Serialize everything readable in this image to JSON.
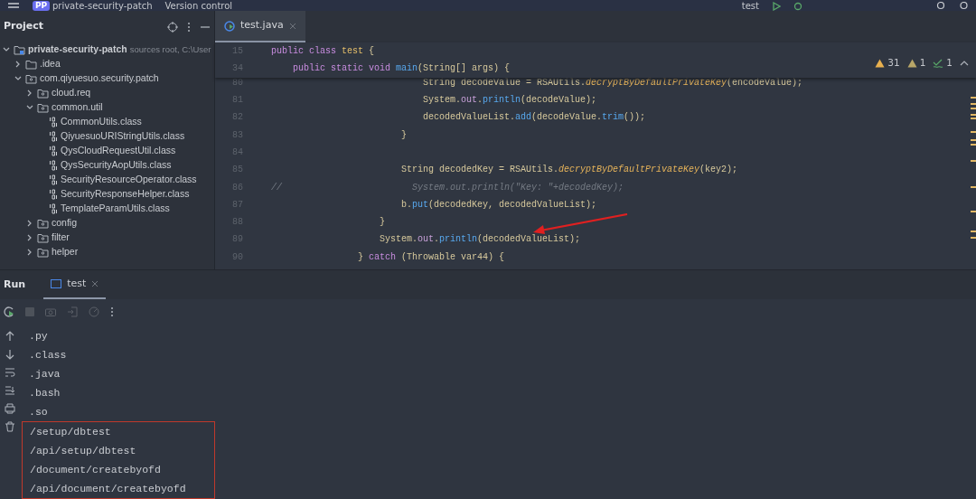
{
  "toolbar": {
    "project_badge": "PP",
    "project_name": "private-security-patch",
    "vcs": "Version control",
    "run_config": "test"
  },
  "project_panel": {
    "title": "Project",
    "tree": [
      {
        "label": "private-security-patch",
        "kind": "module",
        "bold": true,
        "hint": "sources root,  C:\\User",
        "expanded": true,
        "children": [
          {
            "label": ".idea",
            "kind": "folder",
            "expanded": false
          },
          {
            "label": "com.qiyuesuo.security.patch",
            "kind": "package",
            "expanded": true,
            "children": [
              {
                "label": "cloud.req",
                "kind": "package",
                "expanded": false
              },
              {
                "label": "common.util",
                "kind": "package",
                "expanded": true,
                "children": [
                  {
                    "label": "CommonUtils.class",
                    "kind": "class"
                  },
                  {
                    "label": "QiyuesuoURIStringUtils.class",
                    "kind": "class"
                  },
                  {
                    "label": "QysCloudRequestUtil.class",
                    "kind": "class"
                  },
                  {
                    "label": "QysSecurityAopUtils.class",
                    "kind": "class"
                  },
                  {
                    "label": "SecurityResourceOperator.class",
                    "kind": "class"
                  },
                  {
                    "label": "SecurityResponseHelper.class",
                    "kind": "class"
                  },
                  {
                    "label": "TemplateParamUtils.class",
                    "kind": "class"
                  }
                ]
              },
              {
                "label": "config",
                "kind": "package",
                "expanded": false
              },
              {
                "label": "filter",
                "kind": "package",
                "expanded": false
              },
              {
                "label": "helper",
                "kind": "package",
                "expanded": false
              }
            ]
          }
        ]
      }
    ]
  },
  "editor": {
    "tabs": [
      {
        "label": "test.java",
        "selected": true
      }
    ],
    "inspections": {
      "warnings": "31",
      "weak_warnings": "1",
      "typos": "1"
    },
    "sticky_lines": [
      {
        "number": "15",
        "tokens": [
          {
            "t": "public class ",
            "kind": "kw"
          },
          {
            "t": "test",
            "kind": "cls"
          },
          {
            "t": " {",
            "kind": "p"
          }
        ]
      },
      {
        "number": "34",
        "tokens": [
          {
            "t": "    public static void ",
            "kind": "kw"
          },
          {
            "t": "main",
            "kind": "fn"
          },
          {
            "t": "(String[] args) {",
            "kind": "p"
          }
        ]
      }
    ],
    "lines": [
      {
        "number": "80",
        "tokens": [
          {
            "t": "                            String decodeValue = RSAUtils.",
            "kind": "p"
          },
          {
            "t": "decryptByDefaultPrivateKey",
            "kind": "st"
          },
          {
            "t": "(encodeValue);",
            "kind": "p"
          }
        ]
      },
      {
        "number": "81",
        "tokens": [
          {
            "t": "                            System.",
            "kind": "p"
          },
          {
            "t": "out",
            "kind": "fld"
          },
          {
            "t": ".",
            "kind": "p"
          },
          {
            "t": "println",
            "kind": "fn"
          },
          {
            "t": "(decodeValue);",
            "kind": "p"
          }
        ]
      },
      {
        "number": "82",
        "tokens": [
          {
            "t": "                            decodedValueList.",
            "kind": "p"
          },
          {
            "t": "add",
            "kind": "fn"
          },
          {
            "t": "(decodeValue.",
            "kind": "p"
          },
          {
            "t": "trim",
            "kind": "fn"
          },
          {
            "t": "());",
            "kind": "p"
          }
        ]
      },
      {
        "number": "83",
        "tokens": [
          {
            "t": "                        }",
            "kind": "p"
          }
        ]
      },
      {
        "number": "84"
      },
      {
        "number": "85",
        "tokens": [
          {
            "t": "                        String decodedKey = RSAUtils.",
            "kind": "p"
          },
          {
            "t": "decryptByDefaultPrivateKey",
            "kind": "st"
          },
          {
            "t": "(key2);",
            "kind": "p"
          }
        ]
      },
      {
        "number": "86",
        "tokens": [
          {
            "t": "//                        System.out.println(\"Key: \"+decodedKey);",
            "kind": "cm"
          }
        ]
      },
      {
        "number": "87",
        "tokens": [
          {
            "t": "                        b.",
            "kind": "p"
          },
          {
            "t": "put",
            "kind": "fn"
          },
          {
            "t": "(decodedKey, decodedValueList);",
            "kind": "p"
          }
        ]
      },
      {
        "number": "88",
        "tokens": [
          {
            "t": "                    }",
            "kind": "p"
          }
        ]
      },
      {
        "number": "89",
        "tokens": [
          {
            "t": "                    System.",
            "kind": "p"
          },
          {
            "t": "out",
            "kind": "fld"
          },
          {
            "t": ".",
            "kind": "p"
          },
          {
            "t": "println",
            "kind": "fn"
          },
          {
            "t": "(decodedValueList);",
            "kind": "p"
          }
        ]
      },
      {
        "number": "90",
        "tokens": [
          {
            "t": "                } ",
            "kind": "p"
          },
          {
            "t": "catch",
            "kind": "kw"
          },
          {
            "t": " (Throwable var44) {",
            "kind": "p"
          }
        ]
      }
    ]
  },
  "run_panel": {
    "title": "Run",
    "tabs": [
      {
        "label": "test",
        "selected": true
      }
    ],
    "output": [
      ".py",
      ".class",
      ".java",
      ".bash",
      ".so"
    ],
    "boxed_output": [
      "/setup/dbtest",
      "/api/setup/dbtest",
      "/document/createbyofd",
      "/api/document/createbyofd"
    ]
  }
}
